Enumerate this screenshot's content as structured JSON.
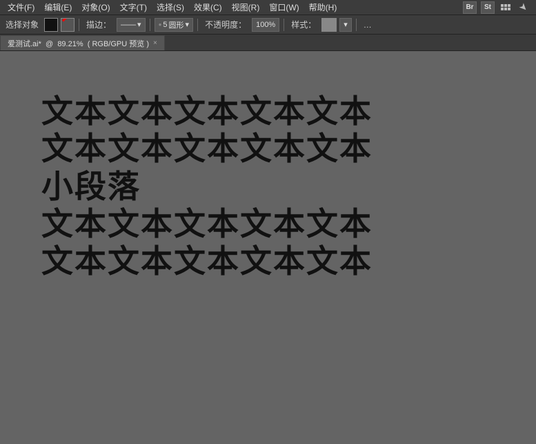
{
  "menubar": {
    "items": [
      {
        "id": "file",
        "label": "文件(F)"
      },
      {
        "id": "edit",
        "label": "编辑(E)"
      },
      {
        "id": "object",
        "label": "对象(O)"
      },
      {
        "id": "text",
        "label": "文字(T)"
      },
      {
        "id": "select",
        "label": "选择(S)"
      },
      {
        "id": "effect",
        "label": "效果(C)"
      },
      {
        "id": "view",
        "label": "视图(R)"
      },
      {
        "id": "window",
        "label": "窗口(W)"
      },
      {
        "id": "help",
        "label": "帮助(H)"
      }
    ],
    "bridge_label": "Br",
    "stock_label": "St"
  },
  "toolbar": {
    "select_object_label": "选择对象",
    "stroke_label": "描边：",
    "brush_size": "5",
    "brush_shape": "圆形",
    "opacity_label": "不透明度：",
    "opacity_value": "100%",
    "style_label": "样式："
  },
  "tab": {
    "filename": "爱测试.ai*",
    "zoom": "89.21%",
    "colormode": "RGB/GPU 预览",
    "close_label": "×"
  },
  "canvas": {
    "text_line1": "文本文本文本文本文本",
    "text_line2": "文本文本文本文本文本",
    "text_line3": "小段落",
    "text_line4": "文本文本文本文本文本",
    "text_line5": "文本文本文本文本文本"
  },
  "icons": {
    "grid": "grid-icon",
    "send": "➤",
    "chevron_up": "▲",
    "chevron_down": "▼"
  }
}
